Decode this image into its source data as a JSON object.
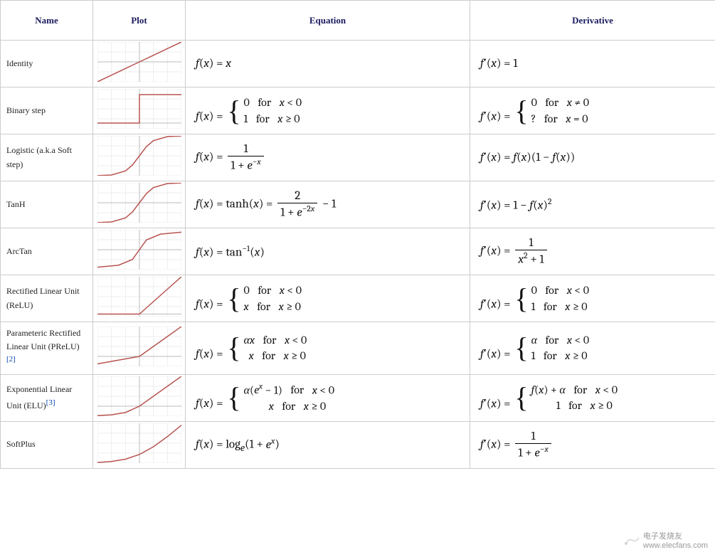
{
  "headers": {
    "name": "Name",
    "plot": "Plot",
    "equation": "Equation",
    "derivative": "Derivative"
  },
  "rows": [
    {
      "name": "Identity",
      "plot_type": "identity",
      "equation_html": "<span class='f-of-x'>f</span>(<span class='f-of-x'>x</span>) = <span class='f-of-x'>x</span>",
      "derivative_html": "<span class='f-of-x'>f</span>&prime;(<span class='f-of-x'>x</span>) = 1"
    },
    {
      "name": "Binary step",
      "plot_type": "step",
      "equation_html": "<span class='f-of-x'>f</span>(<span class='f-of-x'>x</span>) = <span class='brace-block'><span class='brace'>{</span><span class='brace-rows'><span class='brace-row'>0 <span class='for'>for</span> <span class='f-of-x'>x</span> &lt; 0</span><span class='brace-row'>1 <span class='for'>for</span> <span class='f-of-x'>x</span> &ge; 0</span></span></span>",
      "derivative_html": "<span class='f-of-x'>f</span>&prime;(<span class='f-of-x'>x</span>) = <span class='brace-block'><span class='brace'>{</span><span class='brace-rows'><span class='brace-row'>0 <span class='for'>for</span> <span class='f-of-x'>x</span> &ne; 0</span><span class='brace-row'>? <span class='for'>for</span> <span class='f-of-x'>x</span> = 0</span></span></span>"
    },
    {
      "name": "Logistic (a.k.a Soft step)",
      "plot_type": "sigmoid",
      "equation_html": "<span class='f-of-x'>f</span>(<span class='f-of-x'>x</span>) = <span class='frac'><span class='num'>1</span><span class='den'>1 + <span class='f-of-x'>e</span><sup>&minus;<span class='f-of-x'>x</span></sup></span></span>",
      "derivative_html": "<span class='f-of-x'>f</span>&prime;(<span class='f-of-x'>x</span>) = <span class='f-of-x'>f</span>(<span class='f-of-x'>x</span>)(1 &minus; <span class='f-of-x'>f</span>(<span class='f-of-x'>x</span>))"
    },
    {
      "name": "TanH",
      "plot_type": "tanh",
      "equation_html": "<span class='f-of-x'>f</span>(<span class='f-of-x'>x</span>) = tanh(<span class='f-of-x'>x</span>) = <span class='frac'><span class='num'>2</span><span class='den'>1 + <span class='f-of-x'>e</span><sup>&minus;2<span class='f-of-x'>x</span></sup></span></span> &minus; 1",
      "derivative_html": "<span class='f-of-x'>f</span>&prime;(<span class='f-of-x'>x</span>) = 1 &minus; <span class='f-of-x'>f</span>(<span class='f-of-x'>x</span>)<sup>2</sup>"
    },
    {
      "name": "ArcTan",
      "plot_type": "arctan",
      "equation_html": "<span class='f-of-x'>f</span>(<span class='f-of-x'>x</span>) = tan<sup>&minus;1</sup>(<span class='f-of-x'>x</span>)",
      "derivative_html": "<span class='f-of-x'>f</span>&prime;(<span class='f-of-x'>x</span>) = <span class='frac'><span class='num'>1</span><span class='den'><span class='f-of-x'>x</span><sup>2</sup> + 1</span></span>"
    },
    {
      "name": "Rectified Linear Unit (ReLU)",
      "plot_type": "relu",
      "equation_html": "<span class='f-of-x'>f</span>(<span class='f-of-x'>x</span>) = <span class='brace-block'><span class='brace'>{</span><span class='brace-rows'><span class='brace-row'>0 <span class='for'>for</span> <span class='f-of-x'>x</span> &lt; 0</span><span class='brace-row'><span class='f-of-x'>x</span> <span class='for'>for</span> <span class='f-of-x'>x</span> &ge; 0</span></span></span>",
      "derivative_html": "<span class='f-of-x'>f</span>&prime;(<span class='f-of-x'>x</span>) = <span class='brace-block'><span class='brace'>{</span><span class='brace-rows'><span class='brace-row'>0 <span class='for'>for</span> <span class='f-of-x'>x</span> &lt; 0</span><span class='brace-row'>1 <span class='for'>for</span> <span class='f-of-x'>x</span> &ge; 0</span></span></span>"
    },
    {
      "name": "Parameteric Rectified Linear Unit (PReLU)",
      "ref": "[2]",
      "plot_type": "prelu",
      "equation_html": "<span class='f-of-x'>f</span>(<span class='f-of-x'>x</span>) = <span class='brace-block'><span class='brace'>{</span><span class='brace-rows'><span class='brace-row'><span class='f-of-x'>&alpha;x</span> <span class='for'>for</span> <span class='f-of-x'>x</span> &lt; 0</span><span class='brace-row'>&nbsp;&nbsp;<span class='f-of-x'>x</span> <span class='for'>for</span> <span class='f-of-x'>x</span> &ge; 0</span></span></span>",
      "derivative_html": "<span class='f-of-x'>f</span>&prime;(<span class='f-of-x'>x</span>) = <span class='brace-block'><span class='brace'>{</span><span class='brace-rows'><span class='brace-row'><span class='f-of-x'>&alpha;</span> <span class='for'>for</span> <span class='f-of-x'>x</span> &lt; 0</span><span class='brace-row'>1 <span class='for'>for</span> <span class='f-of-x'>x</span> &ge; 0</span></span></span>"
    },
    {
      "name": "Exponential Linear Unit (ELU)",
      "ref": "[3]",
      "plot_type": "elu",
      "equation_html": "<span class='f-of-x'>f</span>(<span class='f-of-x'>x</span>) = <span class='brace-block'><span class='brace'>{</span><span class='brace-rows'><span class='brace-row'><span class='f-of-x'>&alpha;</span>(<span class='f-of-x'>e<sup>x</sup></span> &minus; 1) <span class='for'>for</span> <span class='f-of-x'>x</span> &lt; 0</span><span class='brace-row'>&nbsp;&nbsp;&nbsp;&nbsp;&nbsp;&nbsp;&nbsp;&nbsp;&nbsp;&nbsp;<span class='f-of-x'>x</span> <span class='for'>for</span> <span class='f-of-x'>x</span> &ge; 0</span></span></span>",
      "derivative_html": "<span class='f-of-x'>f</span>&prime;(<span class='f-of-x'>x</span>) = <span class='brace-block'><span class='brace'>{</span><span class='brace-rows'><span class='brace-row'><span class='f-of-x'>f</span>(<span class='f-of-x'>x</span>) + <span class='f-of-x'>&alpha;</span> <span class='for'>for</span> <span class='f-of-x'>x</span> &lt; 0</span><span class='brace-row'>&nbsp;&nbsp;&nbsp;&nbsp;&nbsp;&nbsp;&nbsp;&nbsp;&nbsp;&nbsp;1 <span class='for'>for</span> <span class='f-of-x'>x</span> &ge; 0</span></span></span>"
    },
    {
      "name": "SoftPlus",
      "plot_type": "softplus",
      "equation_html": "<span class='f-of-x'>f</span>(<span class='f-of-x'>x</span>) = log<sub><span class='f-of-x'>e</span></sub>(1 + <span class='f-of-x'>e<sup>x</sup></span>)",
      "derivative_html": "<span class='f-of-x'>f</span>&prime;(<span class='f-of-x'>x</span>) = <span class='frac'><span class='num'>1</span><span class='den'>1 + <span class='f-of-x'>e</span><sup>&minus;<span class='f-of-x'>x</span></sup></span></span>"
    }
  ],
  "watermark": {
    "brand": "电子发烧友",
    "url": "www.elecfans.com"
  },
  "chart_data": [
    {
      "type": "line",
      "name": "identity",
      "x": [
        -3,
        -2,
        -1,
        0,
        1,
        2,
        3
      ],
      "y": [
        -3,
        -2,
        -1,
        0,
        1,
        2,
        3
      ],
      "xlim": [
        -3,
        3
      ],
      "ylim": [
        -3,
        3
      ]
    },
    {
      "type": "line",
      "name": "step",
      "x": [
        -3,
        -0.001,
        0,
        3
      ],
      "y": [
        0,
        0,
        1,
        1
      ],
      "xlim": [
        -3,
        3
      ],
      "ylim": [
        -0.2,
        1.2
      ]
    },
    {
      "type": "line",
      "name": "sigmoid",
      "x": [
        -6,
        -4,
        -2,
        -1,
        0,
        1,
        2,
        4,
        6
      ],
      "y": [
        0.0025,
        0.018,
        0.119,
        0.269,
        0.5,
        0.731,
        0.881,
        0.982,
        0.998
      ],
      "xlim": [
        -6,
        6
      ],
      "ylim": [
        0,
        1
      ]
    },
    {
      "type": "line",
      "name": "tanh",
      "x": [
        -3,
        -2,
        -1,
        -0.5,
        0,
        0.5,
        1,
        2,
        3
      ],
      "y": [
        -0.995,
        -0.964,
        -0.762,
        -0.462,
        0,
        0.462,
        0.762,
        0.964,
        0.995
      ],
      "xlim": [
        -3,
        3
      ],
      "ylim": [
        -1,
        1
      ]
    },
    {
      "type": "line",
      "name": "arctan",
      "x": [
        -6,
        -3,
        -1,
        0,
        1,
        3,
        6
      ],
      "y": [
        -1.406,
        -1.249,
        -0.785,
        0,
        0.785,
        1.249,
        1.406
      ],
      "xlim": [
        -6,
        6
      ],
      "ylim": [
        -1.6,
        1.6
      ]
    },
    {
      "type": "line",
      "name": "relu",
      "x": [
        -3,
        -2,
        -1,
        0,
        1,
        2,
        3
      ],
      "y": [
        0,
        0,
        0,
        0,
        1,
        2,
        3
      ],
      "xlim": [
        -3,
        3
      ],
      "ylim": [
        -0.2,
        3
      ]
    },
    {
      "type": "line",
      "name": "prelu",
      "x": [
        -3,
        -2,
        -1,
        0,
        1,
        2,
        3
      ],
      "y": [
        -0.75,
        -0.5,
        -0.25,
        0,
        1,
        2,
        3
      ],
      "xlim": [
        -3,
        3
      ],
      "ylim": [
        -1,
        3
      ]
    },
    {
      "type": "line",
      "name": "elu",
      "x": [
        -3,
        -2,
        -1,
        0,
        1,
        2,
        3
      ],
      "y": [
        -0.95,
        -0.865,
        -0.632,
        0,
        1,
        2,
        3
      ],
      "xlim": [
        -3,
        3
      ],
      "ylim": [
        -1,
        3
      ]
    },
    {
      "type": "line",
      "name": "softplus",
      "x": [
        -3,
        -2,
        -1,
        0,
        1,
        2,
        3
      ],
      "y": [
        0.049,
        0.127,
        0.313,
        0.693,
        1.313,
        2.127,
        3.049
      ],
      "xlim": [
        -3,
        3
      ],
      "ylim": [
        0,
        3.2
      ]
    }
  ]
}
